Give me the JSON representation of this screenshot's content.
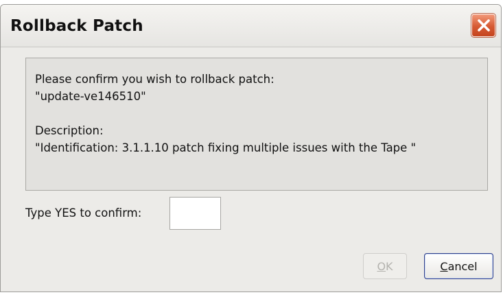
{
  "window": {
    "title": "Rollback Patch"
  },
  "message": {
    "prompt": "Please confirm you wish to rollback patch:",
    "patch_name": "\"update-ve146510\"",
    "description_label": "Description:",
    "description_text": "\"Identification: 3.1.1.10 patch fixing multiple issues with the Tape \""
  },
  "confirm": {
    "label": "Type YES to confirm:",
    "value": ""
  },
  "buttons": {
    "ok": {
      "mnemonic": "O",
      "rest": "K",
      "enabled": false
    },
    "cancel": {
      "mnemonic": "C",
      "rest": "ancel"
    }
  },
  "icons": {
    "close": "close-x-icon"
  },
  "colors": {
    "close_button": "#d65a33",
    "focus_border": "#2f3f8a"
  }
}
